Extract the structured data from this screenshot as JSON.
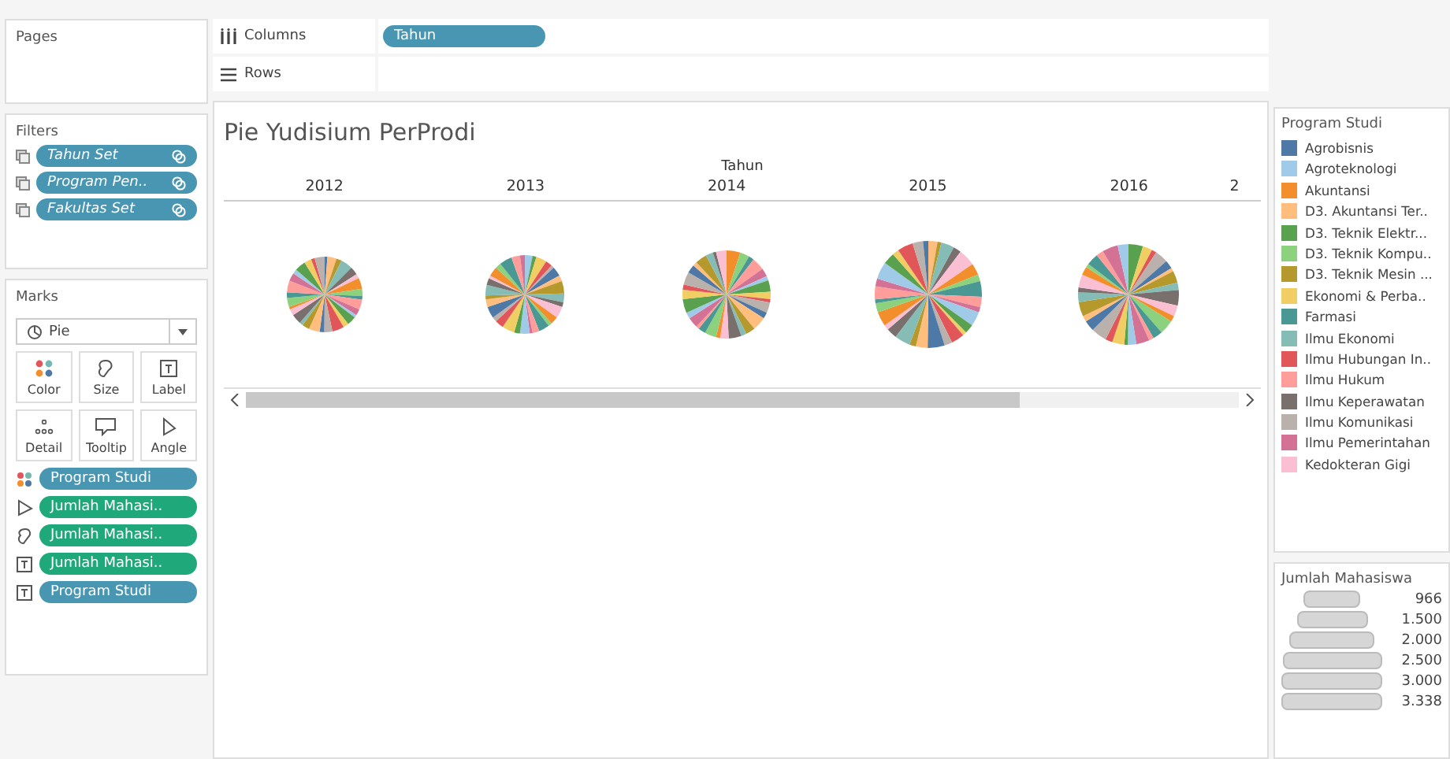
{
  "pages": {
    "title": "Pages"
  },
  "shelves": [
    {
      "kind": "columns",
      "label": "Columns",
      "pills": [
        "Tahun"
      ]
    },
    {
      "kind": "rows",
      "label": "Rows"
    }
  ],
  "filters": {
    "title": "Filters",
    "items": [
      "Tahun Set",
      "Program Pen..",
      "Fakultas Set"
    ]
  },
  "marks": {
    "title": "Marks",
    "type": "Pie",
    "cards": [
      {
        "kind": "color",
        "label": "Color"
      },
      {
        "kind": "size",
        "label": "Size"
      },
      {
        "kind": "label",
        "label": "Label"
      },
      {
        "kind": "detail",
        "label": "Detail"
      },
      {
        "kind": "tooltip",
        "label": "Tooltip"
      },
      {
        "kind": "angle",
        "label": "Angle"
      }
    ],
    "pills": [
      {
        "kind": "color",
        "color": "#4996b2",
        "label": "Program Studi"
      },
      {
        "kind": "angle",
        "color": "#1fa97a",
        "label": "Jumlah Mahasi.."
      },
      {
        "kind": "size",
        "color": "#1fa97a",
        "label": "Jumlah Mahasi.."
      },
      {
        "kind": "label",
        "color": "#1fa97a",
        "label": "Jumlah Mahasi.."
      },
      {
        "kind": "label",
        "color": "#4996b2",
        "label": "Program Studi"
      }
    ]
  },
  "view": {
    "title": "Pie Yudisium PerProdi",
    "axis_title": "Tahun",
    "columns": [
      "2012",
      "2013",
      "2014",
      "2015",
      "2016",
      "2"
    ]
  },
  "color_legend": {
    "title": "Program Studi",
    "items": [
      {
        "label": "Agrobisnis",
        "color": "#4e79a7"
      },
      {
        "label": "Agroteknologi",
        "color": "#a0cbe8"
      },
      {
        "label": "Akuntansi",
        "color": "#f28e2b"
      },
      {
        "label": "D3. Akuntansi Ter..",
        "color": "#ffbe7d"
      },
      {
        "label": "D3. Teknik Elektr...",
        "color": "#59a14f"
      },
      {
        "label": "D3. Teknik Kompu..",
        "color": "#8cd17d"
      },
      {
        "label": "D3. Teknik Mesin ...",
        "color": "#b6992d"
      },
      {
        "label": "Ekonomi & Perba..",
        "color": "#f1ce63"
      },
      {
        "label": "Farmasi",
        "color": "#499894"
      },
      {
        "label": "Ilmu Ekonomi",
        "color": "#86bcb6"
      },
      {
        "label": "Ilmu Hubungan In..",
        "color": "#e15759"
      },
      {
        "label": "Ilmu Hukum",
        "color": "#ff9d9a"
      },
      {
        "label": "Ilmu Keperawatan",
        "color": "#79706e"
      },
      {
        "label": "Ilmu Komunikasi",
        "color": "#bab0ac"
      },
      {
        "label": "Ilmu Pemerintahan",
        "color": "#d37295"
      },
      {
        "label": "Kedokteran Gigi",
        "color": "#fabfd2"
      }
    ]
  },
  "size_legend": {
    "title": "Jumlah Mahasiswa",
    "items": [
      "966",
      "1.500",
      "2.000",
      "2.500",
      "3.000",
      "3.338"
    ]
  }
}
